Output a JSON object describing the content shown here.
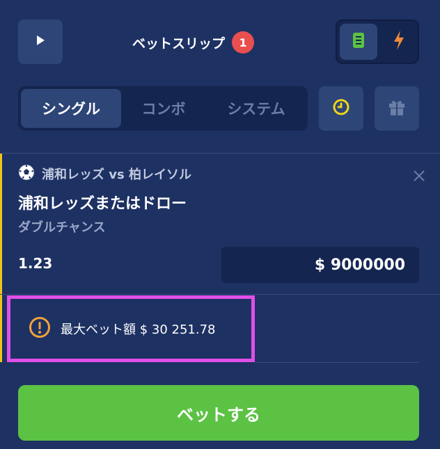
{
  "header": {
    "title": "ベットスリップ",
    "badge_count": "1"
  },
  "tabs": [
    {
      "label": "シングル",
      "active": true
    },
    {
      "label": "コンボ",
      "active": false
    },
    {
      "label": "システム",
      "active": false
    }
  ],
  "bet": {
    "match": "浦和レッズ vs 柏レイソル",
    "selection": "浦和レッズまたはドロー",
    "market": "ダブルチャンス",
    "odds": "1.23",
    "stake": "$ 9000000"
  },
  "warning": {
    "text": "最大ベット額 $ 30 251.78"
  },
  "submit": {
    "label": "ベットする"
  },
  "colors": {
    "background": "#1e3163",
    "accent_green": "#5bc243",
    "badge_red": "#ea4f4f",
    "highlight_magenta": "#e04fe8",
    "warning_orange": "#f0a33a"
  },
  "icons": [
    "play-icon",
    "list-icon",
    "lightning-icon",
    "history-icon",
    "gift-icon",
    "soccer-ball-icon",
    "close-icon",
    "warning-icon"
  ]
}
